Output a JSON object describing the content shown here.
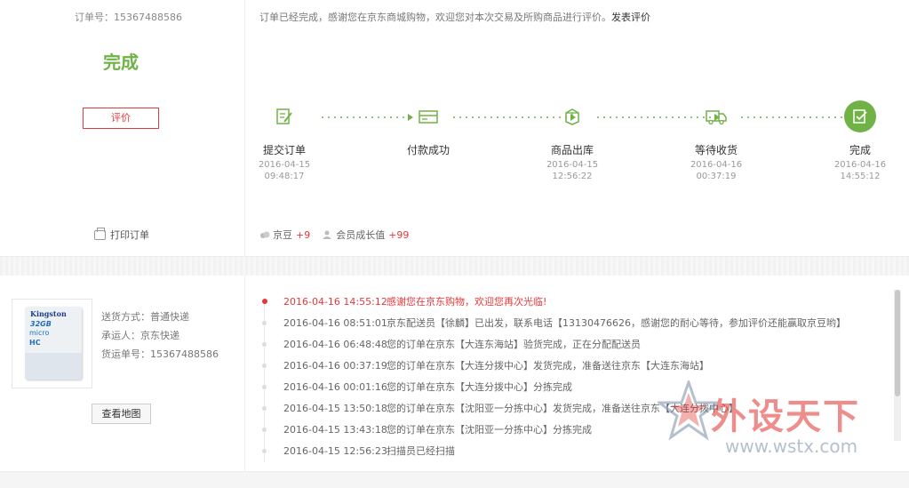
{
  "order": {
    "order_no_label": "订单号：15367488586",
    "status": "完成",
    "review_button": "评价",
    "print_label": "打印订单",
    "notice_text": "订单已经完成，感谢您在京东商城购物，欢迎您对本次交易及所购商品进行评价。",
    "notice_link": "发表评价"
  },
  "steps": [
    {
      "name": "提交订单",
      "date": "2016-04-15",
      "time": "09:48:17",
      "icon": "form-edit-icon"
    },
    {
      "name": "付款成功",
      "date": "",
      "time": "",
      "icon": "card-payment-icon"
    },
    {
      "name": "商品出库",
      "date": "2016-04-15",
      "time": "12:56:22",
      "icon": "package-out-icon"
    },
    {
      "name": "等待收货",
      "date": "2016-04-16",
      "time": "00:37:19",
      "icon": "truck-icon"
    },
    {
      "name": "完成",
      "date": "2016-04-16",
      "time": "14:55:12",
      "icon": "check-done-icon"
    }
  ],
  "rewards": {
    "jingdou_label": "京豆",
    "jingdou_value": "+9",
    "growth_label": "会员成长值",
    "growth_value": "+99"
  },
  "shipping": {
    "method": "送货方式：普通快递",
    "carrier": "承运人：京东快递",
    "tracking_no": "货运单号：15367488586",
    "map_button": "查看地图",
    "product_brand": "Kingston",
    "product_capacity": "32GB",
    "product_type": "micro",
    "product_class": "HC"
  },
  "tracking": [
    {
      "time": "2016-04-16 14:55:12",
      "text": "感谢您在京东购物，欢迎您再次光临!"
    },
    {
      "time": "2016-04-16 08:51:01",
      "text": "京东配送员【徐麟】已出发，联系电话【13130476626，感谢您的耐心等待，参加评价还能赢取京豆哟】"
    },
    {
      "time": "2016-04-16 06:48:48",
      "text": "您的订单在京东【大连东海站】验货完成，正在分配配送员"
    },
    {
      "time": "2016-04-16 00:37:19",
      "text": "您的订单在京东【大连分拨中心】发货完成，准备送往京东【大连东海站】"
    },
    {
      "time": "2016-04-16 00:01:16",
      "text": "您的订单在京东【大连分拨中心】分拣完成"
    },
    {
      "time": "2016-04-15 13:50:18",
      "text": "您的订单在京东【沈阳亚一分拣中心】发货完成，准备送往京东【大连分拨中心】"
    },
    {
      "time": "2016-04-15 13:43:18",
      "text": "您的订单在京东【沈阳亚一分拣中心】分拣完成"
    },
    {
      "time": "2016-04-15 12:56:23",
      "text": "扫描员已经扫描"
    }
  ],
  "watermark": {
    "title": "外设天下",
    "url": "www.wstx.com"
  },
  "colors": {
    "accent_green": "#71b247",
    "accent_red": "#e4393c"
  }
}
